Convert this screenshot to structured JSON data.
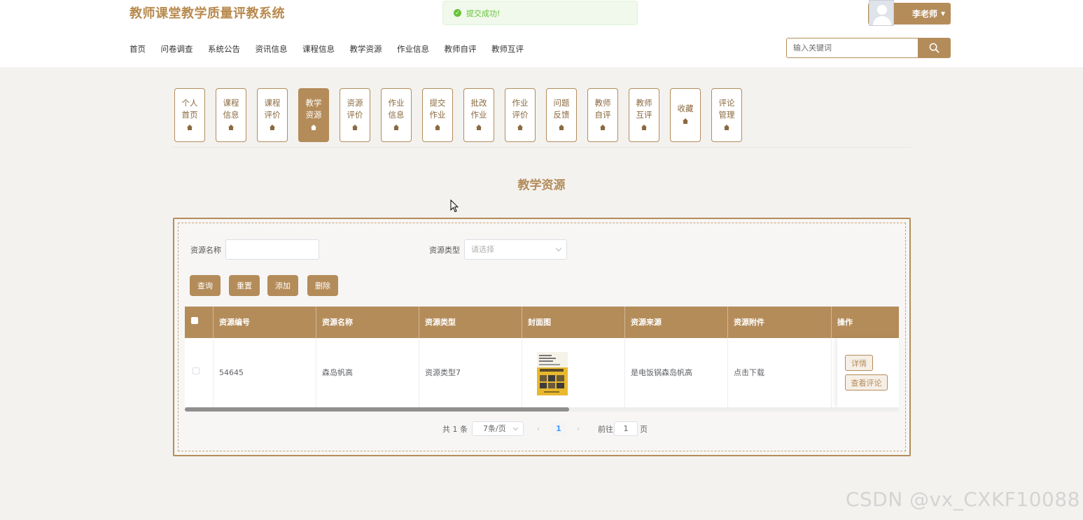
{
  "header": {
    "site_title": "教师课堂教学质量评教系统",
    "toast": "提交成功!",
    "user_name": "李老师",
    "search_placeholder": "输入关键词"
  },
  "nav": [
    "首页",
    "问卷调查",
    "系统公告",
    "资讯信息",
    "课程信息",
    "教学资源",
    "作业信息",
    "教师自评",
    "教师互评"
  ],
  "center_menu": [
    {
      "label": "个人首页",
      "active": false
    },
    {
      "label": "课程信息",
      "active": false
    },
    {
      "label": "课程评价",
      "active": false
    },
    {
      "label": "教学资源",
      "active": true
    },
    {
      "label": "资源评价",
      "active": false
    },
    {
      "label": "作业信息",
      "active": false
    },
    {
      "label": "提交作业",
      "active": false
    },
    {
      "label": "批改作业",
      "active": false
    },
    {
      "label": "作业评价",
      "active": false
    },
    {
      "label": "问题反馈",
      "active": false
    },
    {
      "label": "教师自评",
      "active": false
    },
    {
      "label": "教师互评",
      "active": false
    },
    {
      "label": "收藏",
      "active": false
    },
    {
      "label": "评论管理",
      "active": false
    }
  ],
  "page_title": "教学资源",
  "filters": {
    "name_label": "资源名称",
    "name_value": "",
    "type_label": "资源类型",
    "type_placeholder": "请选择"
  },
  "actions": {
    "query": "查询",
    "reset": "重置",
    "add": "添加",
    "delete": "删除"
  },
  "table": {
    "columns": [
      "资源编号",
      "资源名称",
      "资源类型",
      "封面图",
      "资源来源",
      "资源附件",
      "操作"
    ],
    "rows": [
      {
        "id": "54645",
        "name": "森岛帆高",
        "type": "资源类型7",
        "source": "是电饭锅森岛帆高",
        "attachment": "点击下载",
        "detail_btn": "详情",
        "comment_btn": "查看评论"
      }
    ]
  },
  "pagination": {
    "total": "共 1 条",
    "page_size": "7条/页",
    "current": "1",
    "goto_label": "前往",
    "goto_value": "1",
    "page_unit": "页"
  },
  "watermark": "CSDN @vx_CXKF10088",
  "colors": {
    "accent": "#b48c5a",
    "success": "#67c23a",
    "page_bg": "#f3f2ef"
  }
}
